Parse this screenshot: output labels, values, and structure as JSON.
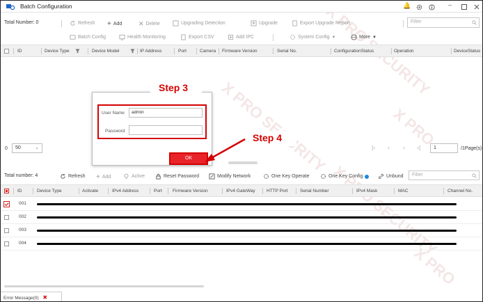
{
  "window": {
    "title": "Batch Configuration",
    "controls": [
      "bell",
      "gear",
      "info",
      "minimize",
      "maximize",
      "close"
    ]
  },
  "toolbar": {
    "total_number": "Total Number: 0",
    "refresh": "Refresh",
    "add": "Add",
    "delete": "Delete",
    "upgrading_detection": "Upgrading Detection",
    "upgrade": "Upgrade",
    "export_upgrade_report": "Export Upgrade Report",
    "filter_placeholder": "Filter",
    "batch_config": "Batch Config",
    "health_monitoring": "Health Monitoring",
    "export_csv": "Export CSV",
    "add_ipc": "Add IPC",
    "system_config": "System Config",
    "more": "More"
  },
  "upper_table": {
    "columns": [
      "ID",
      "Device Type",
      "Device Model",
      "IP Address",
      "Port",
      "Camera",
      "Firmware Version",
      "Serial No.",
      "ConfigurationStatus",
      "Operation",
      "DeviceStatus"
    ]
  },
  "pager": {
    "zero": "0",
    "page_size": "50",
    "page_input": "1",
    "page_total": "/1Page(s)"
  },
  "dialog": {
    "username_label": "User Name",
    "username_value": "admin",
    "password_label": "Password",
    "ok": "OK"
  },
  "annotations": {
    "step3": "Step 3",
    "step4": "Step 4"
  },
  "lower_toolbar": {
    "total_number": "Total number: 4",
    "refresh": "Refresh",
    "add": "Add",
    "activate": "Active",
    "reset_password": "Reset Password",
    "modify_network": "Modify Network",
    "one_key_operate": "One Key Operate",
    "one_key_config": "One Key Config",
    "unbind": "Unbund",
    "filter_placeholder": "Filter"
  },
  "lower_table": {
    "columns": [
      "ID",
      "Device Type",
      "Activate",
      "IPv4 Address",
      "Port",
      "Firmware Version",
      "IPv4 GateWay",
      "HTTP Port",
      "Serial Number",
      "IPv4 Mask",
      "MAC",
      "Channel No."
    ],
    "rows": [
      {
        "id": "001",
        "checked": true
      },
      {
        "id": "002",
        "checked": false
      },
      {
        "id": "003",
        "checked": false
      },
      {
        "id": "004",
        "checked": false
      }
    ]
  },
  "footer": {
    "error_message": "Error Message(0)"
  },
  "watermark_text": "X PRO SECURITY",
  "colors": {
    "accent_red": "#d40000",
    "ok_button": "#e8242a",
    "info_blue": "#1e88e5"
  }
}
